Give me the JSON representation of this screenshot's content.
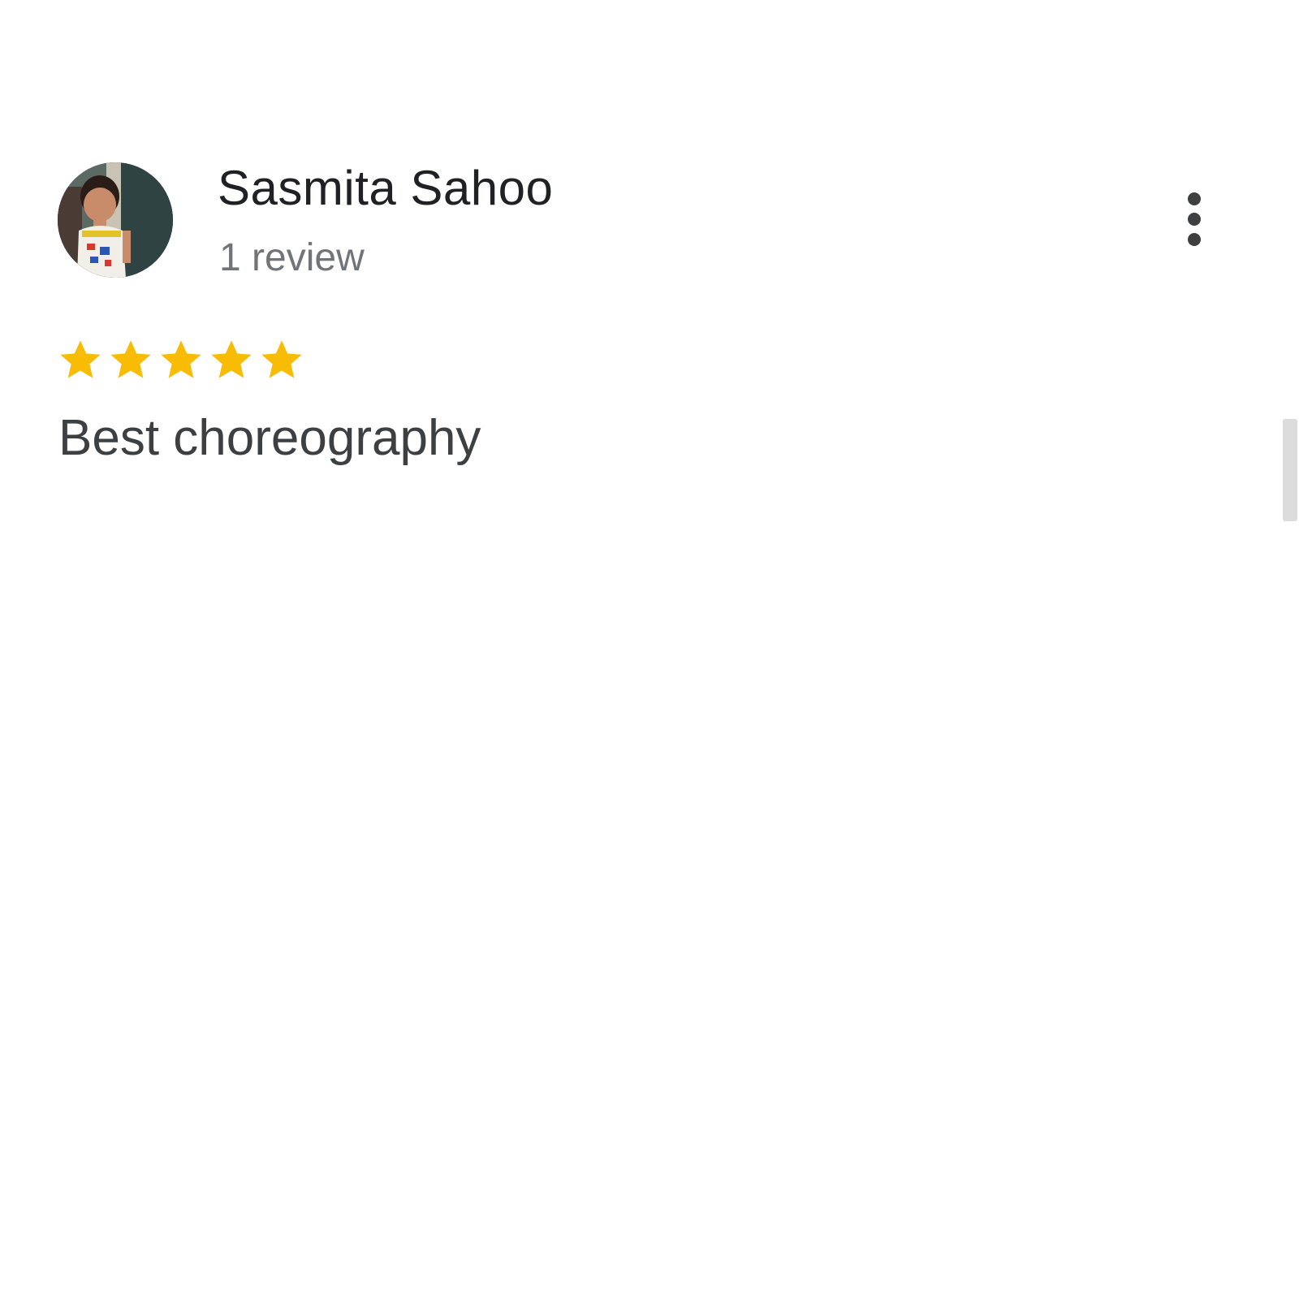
{
  "review": {
    "reviewer_name": "Sasmita Sahoo",
    "review_count": "1 review",
    "rating": 5,
    "rating_max": 5,
    "text": "Best choreography"
  },
  "icons": {
    "avatar": "reviewer-photo-avatar",
    "more": "more-vert-icon",
    "star": "star-filled-icon"
  },
  "colors": {
    "star": "#F9BC05",
    "name": "#202124",
    "secondary": "#70757A",
    "body": "#3C4043",
    "icon": "#3C4043",
    "scrollbar": "#DCDCDC"
  }
}
